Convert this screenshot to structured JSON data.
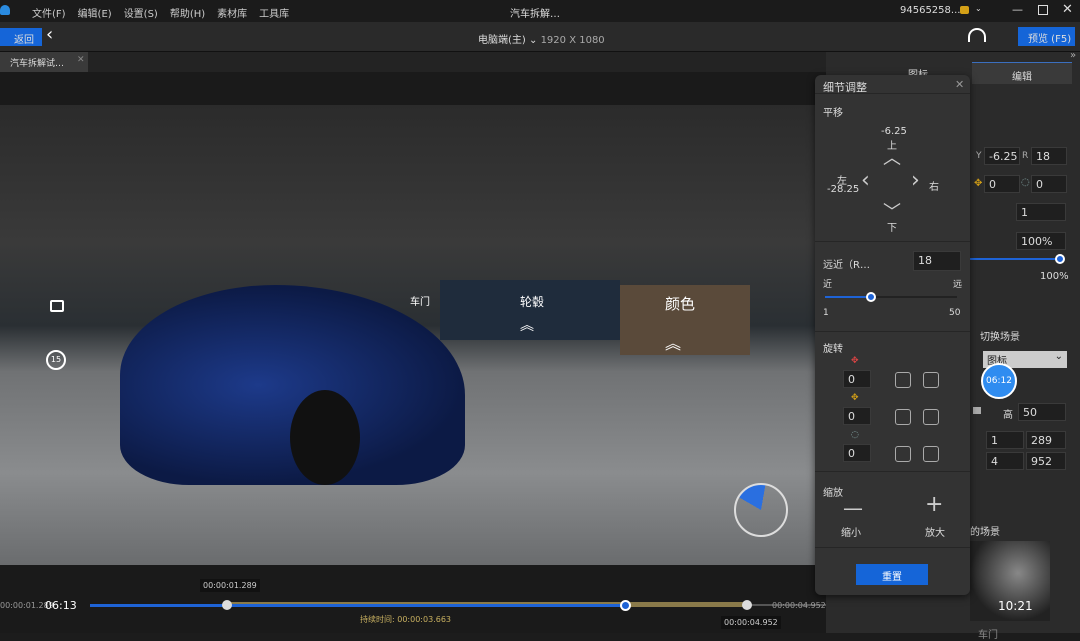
{
  "app": {
    "title": "汽车拆解…",
    "menu": [
      "文件(F)",
      "编辑(E)",
      "设置(S)",
      "帮助(H)",
      "素材库",
      "工具库"
    ],
    "account": "94565258...",
    "accent": "#1565d8"
  },
  "toolbar": {
    "back": "返回",
    "device": "电脑端(主)",
    "resolution": "1920 X 1080",
    "preview": "预览 (F5)"
  },
  "tab": {
    "label": "汽车拆解试…"
  },
  "hotspots": [
    {
      "label": "车门"
    },
    {
      "label": "轮毂"
    },
    {
      "label": "颜色"
    }
  ],
  "viewport": {
    "rotate_badge": "15"
  },
  "timeline": {
    "start": "00:00:01.289",
    "current": "06:13",
    "end": "00:00:04.952",
    "start_tip": "00:00:01.289",
    "end_tip": "00:00:04.952",
    "duration_label": "持续时间:",
    "duration": "00:00:03.663",
    "progress": 0.59
  },
  "right_panel": {
    "tabs": [
      "图标",
      "编辑"
    ],
    "y_label": "Y",
    "y": "-6.25",
    "r_label": "R",
    "r": "18",
    "rot1": "0",
    "rot2": "0",
    "count": "1",
    "opacity": "100%",
    "slider_value": "100%",
    "switch_scene": "切换场景",
    "scene_select": "图标",
    "timer": "06:12",
    "height_label": "高",
    "height": "50",
    "row1": [
      "1",
      "289"
    ],
    "row2": [
      "4",
      "952"
    ],
    "scene_label": "的场景",
    "thumb_time": "10:21",
    "thumb_caption": "车门"
  },
  "dialog": {
    "title": "细节调整",
    "pan": "平移",
    "up": "上",
    "up_val": "-6.25",
    "down": "下",
    "left": "左",
    "left_val": "-28.25",
    "right": "右",
    "distance": "远近（R…",
    "distance_val": "18",
    "near": "近",
    "far": "远",
    "min": "1",
    "max": "50",
    "distance_fraction": 0.35,
    "rotate": "旋转",
    "rot": [
      "0",
      "0",
      "0"
    ],
    "zoom": "缩放",
    "zoom_out": "缩小",
    "zoom_in": "放大",
    "reset": "重置"
  }
}
